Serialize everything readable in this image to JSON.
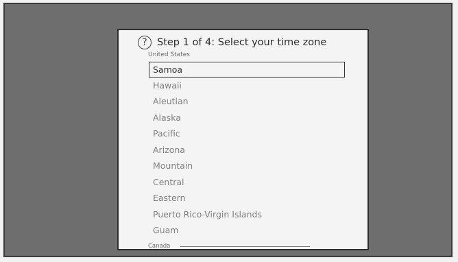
{
  "dialog": {
    "help_icon": "?",
    "title": "Step 1 of 4: Select your time zone",
    "region_label": "United States",
    "time_zones": [
      "Samoa",
      "Hawaii",
      "Aleutian",
      "Alaska",
      "Pacific",
      "Arizona",
      "Mountain",
      "Central",
      "Eastern",
      "Puerto Rico-Virgin Islands",
      "Guam"
    ],
    "selected_index": 0,
    "next_region_label": "Canada"
  },
  "colors": {
    "screen_bg": "#6e6e6e",
    "dialog_bg": "#f4f4f4",
    "selected_border": "#333333"
  }
}
